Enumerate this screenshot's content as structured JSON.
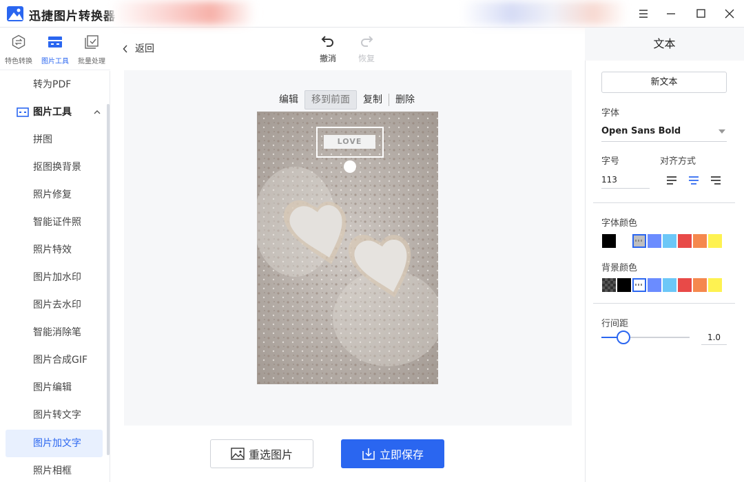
{
  "app": {
    "title": "迅捷图片转换器"
  },
  "left_tabs": [
    {
      "label": "特色转换",
      "icon": "swap-hex-icon"
    },
    {
      "label": "图片工具",
      "icon": "image-tools-icon"
    },
    {
      "label": "批量处理",
      "icon": "batch-check-icon"
    }
  ],
  "sidebar": {
    "top_item": "转为PDF",
    "group_title": "图片工具",
    "items": [
      "拼图",
      "抠图换背景",
      "照片修复",
      "智能证件照",
      "照片特效",
      "图片加水印",
      "图片去水印",
      "智能消除笔",
      "图片合成GIF",
      "图片编辑",
      "图片转文字",
      "图片加文字",
      "照片相框"
    ],
    "active_item": "图片加文字"
  },
  "toolbar": {
    "back_label": "返回",
    "undo_label": "撤消",
    "redo_label": "恢复"
  },
  "context_menu": {
    "edit": "编辑",
    "bring_front": "移到前面",
    "copy": "复制",
    "delete": "删除"
  },
  "canvas": {
    "text_box_content": "LOVE"
  },
  "actions": {
    "reselect_label": "重选图片",
    "save_label": "立即保存"
  },
  "panel": {
    "title": "文本",
    "new_text_label": "新文本",
    "font_label": "字体",
    "font_value": "Open Sans Bold",
    "size_label": "字号",
    "size_value": "113",
    "align_label": "对齐方式",
    "align_selected": "center",
    "font_color_label": "字体颜色",
    "bg_color_label": "背景颜色",
    "line_spacing_label": "行间距",
    "line_spacing_value": "1.0",
    "font_colors": [
      "#000000",
      "#ffffff",
      "#bfbfbf",
      "#6b8cff",
      "#6cc7f7",
      "#e84a48",
      "#f5884e",
      "#fef251"
    ],
    "font_color_selected": 2,
    "bg_colors": [
      "transparent",
      "#000000",
      "#ffffff",
      "#6b8cff",
      "#6cc7f7",
      "#e84a48",
      "#f5884e",
      "#fef251"
    ],
    "bg_color_selected": 2
  },
  "colors": {
    "accent": "#2a66f0"
  }
}
